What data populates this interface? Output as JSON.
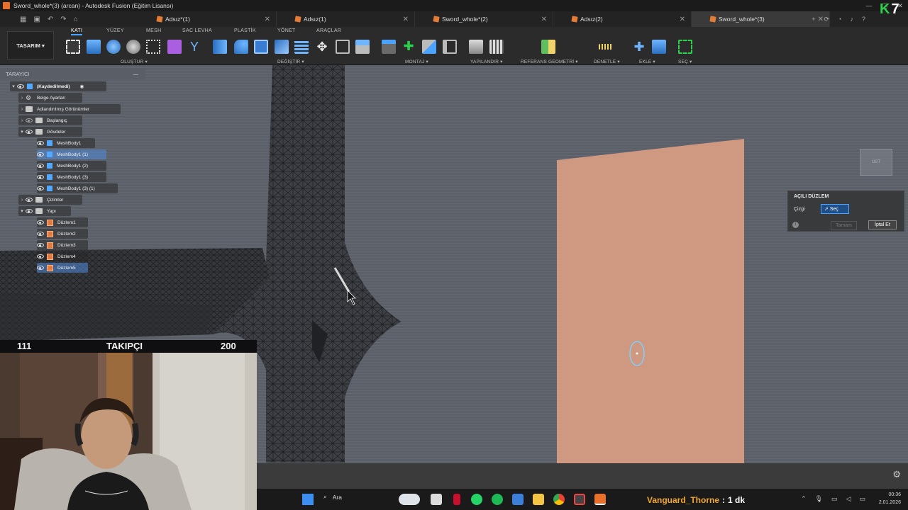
{
  "window": {
    "title": "Sword_whole*(3) (arcan) - Autodesk Fusion (Eğitim Lisansı)"
  },
  "tabs": [
    {
      "label": "Adsız*(1)",
      "active": false
    },
    {
      "label": "Adsız(1)",
      "active": false
    },
    {
      "label": "Sword_whole*(2)",
      "active": false
    },
    {
      "label": "Adsız(2)",
      "active": false
    },
    {
      "label": "Sword_whole*(3)",
      "active": true
    }
  ],
  "ribbon": {
    "workspace": "TASARIM",
    "tabs": [
      "KATI",
      "YÜZEY",
      "MESH",
      "SAC LEVHA",
      "PLASTİK",
      "YÖNET",
      "ARAÇLAR"
    ],
    "active_tab": "KATI",
    "groups": [
      "OLUŞTUR",
      "DEĞİŞTİR",
      "MONTAJ",
      "YAPILANDIR",
      "REFERANS GEOMETRİ",
      "DENETLE",
      "EKLE",
      "SEÇ"
    ]
  },
  "browser": {
    "title": "TARAYICI",
    "items": [
      {
        "label": "(Kaydedilmedi)"
      },
      {
        "label": "Belge Ayarları"
      },
      {
        "label": "Adlandırılmış Görünümler"
      },
      {
        "label": "Başlangıç"
      },
      {
        "label": "Gövdeler"
      },
      {
        "label": "MeshBody1"
      },
      {
        "label": "MeshBody1 (1)"
      },
      {
        "label": "MeshBody1 (2)"
      },
      {
        "label": "MeshBody1 (3)"
      },
      {
        "label": "MeshBody1 (3) (1)"
      },
      {
        "label": "Çizimler"
      },
      {
        "label": "Yapı"
      },
      {
        "label": "Düzlem1"
      },
      {
        "label": "Düzlem2"
      },
      {
        "label": "Düzlem3"
      },
      {
        "label": "Düzlem4"
      },
      {
        "label": "Düzlem5"
      }
    ]
  },
  "dialog": {
    "title": "AÇILI DÜZLEM",
    "line_label": "Çizgi",
    "select_label": "Seç",
    "ok_label": "Tamam",
    "cancel_label": "İptal Et"
  },
  "viewcube": {
    "label": "ÜST"
  },
  "overlay": {
    "followers_current": "111",
    "followers_label": "TAKIPÇI",
    "followers_goal": "200",
    "notify_user": "Vanguard_Thorne",
    "notify_sep": ":",
    "notify_duration": "1 dk"
  },
  "taskbar": {
    "search_label": "Ara",
    "time": "00:36",
    "date": "2.01.2026"
  },
  "colors": {
    "accent": "#4aa3ff",
    "plane": "#e8a586",
    "fusion_orange": "#e8702a"
  }
}
